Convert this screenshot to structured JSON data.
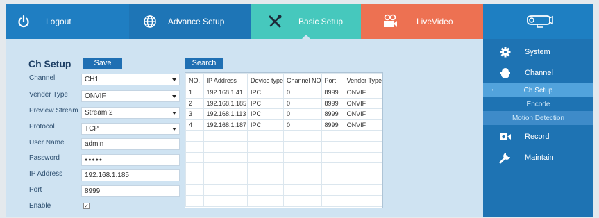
{
  "nav": {
    "logout": "Logout",
    "advance_setup": "Advance Setup",
    "basic_setup": "Basic Setup",
    "live_video": "LiveVideo",
    "logo_icon": "camera-logo-icon"
  },
  "ch_setup": {
    "title": "Ch Setup",
    "save": "Save",
    "search": "Search",
    "fields": {
      "channel": {
        "label": "Channel",
        "value": "CH1"
      },
      "vender_type": {
        "label": "Vender Type",
        "value": "ONVIF"
      },
      "preview_stream": {
        "label": "Preview Stream",
        "value": "Stream 2"
      },
      "protocol": {
        "label": "Protocol",
        "value": "TCP"
      },
      "user_name": {
        "label": "User Name",
        "value": "admin"
      },
      "password": {
        "label": "Password",
        "value": "●●●●●"
      },
      "ip_address": {
        "label": "IP Address",
        "value": "192.168.1.185"
      },
      "port": {
        "label": "Port",
        "value": "8999"
      },
      "enable": {
        "label": "Enable",
        "value": "✓"
      }
    }
  },
  "device_table": {
    "headers": [
      "NO.",
      "IP Address",
      "Device type",
      "Channel NO",
      "Port",
      "Vender Type"
    ],
    "rows": [
      [
        "1",
        "192.168.1.41",
        "IPC",
        "0",
        "8999",
        "ONVIF"
      ],
      [
        "2",
        "192.168.1.185",
        "IPC",
        "0",
        "8999",
        "ONVIF"
      ],
      [
        "3",
        "192.168.1.113",
        "IPC",
        "0",
        "8999",
        "ONVIF"
      ],
      [
        "4",
        "192.168.1.187",
        "IPC",
        "0",
        "8999",
        "ONVIF"
      ]
    ]
  },
  "sidebar": {
    "system": "System",
    "channel": "Channel",
    "ch_setup": "Ch Setup",
    "encode": "Encode",
    "motion_detection": "Motion Detection",
    "record": "Record",
    "maintain": "Maintain"
  }
}
